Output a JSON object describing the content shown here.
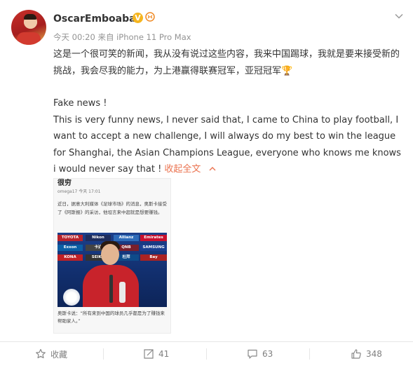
{
  "post": {
    "username": "OscarEmboaba8",
    "vip_badge": "V",
    "kaomoji_badge": "⊱",
    "meta": "今天 00:20 来自 iPhone 11 Pro Max",
    "text_cn": "这是一个很可笑的新闻，我从没有说过这些内容，我来中国踢球，我就是要来接受新的挑战，我会尽我的能力，为上港赢得联赛冠军，亚冠冠军🏆",
    "fake_news": "Fake news !",
    "text_en": "This is very funny news, I never said that, I came to China to play football, I want to accept a new challenge, I will always do my best to win the league for Shanghai, the Asian Champions League, everyone who knows me knows i would never say that ! ",
    "collapse_label": "收起全文"
  },
  "article": {
    "title": "很穷",
    "meta": "omega17  今天 17:01",
    "body": "近日，据意大利媒体《足球市场》的消息，奥斯卡接受了《阿斯报》的采访，他坦言来中超就是想要赚钱。",
    "caption": "奥斯卡说：“所有来到中国的球员几乎都是为了赚钱来帮助家人。”",
    "sponsors": [
      "TOYOTA",
      "Nikon",
      "Allianz",
      "Emirates",
      "Exxon",
      "卡达",
      "QNB",
      "SAMSUNG",
      "KONA",
      "SEIKO",
      "杜拜",
      "Bay"
    ]
  },
  "footer": {
    "favorite_label": "收藏",
    "repost_count": "41",
    "comment_count": "63",
    "like_count": "348"
  },
  "colors": {
    "link": "#eb7350",
    "muted": "#939393",
    "text": "#333333"
  }
}
